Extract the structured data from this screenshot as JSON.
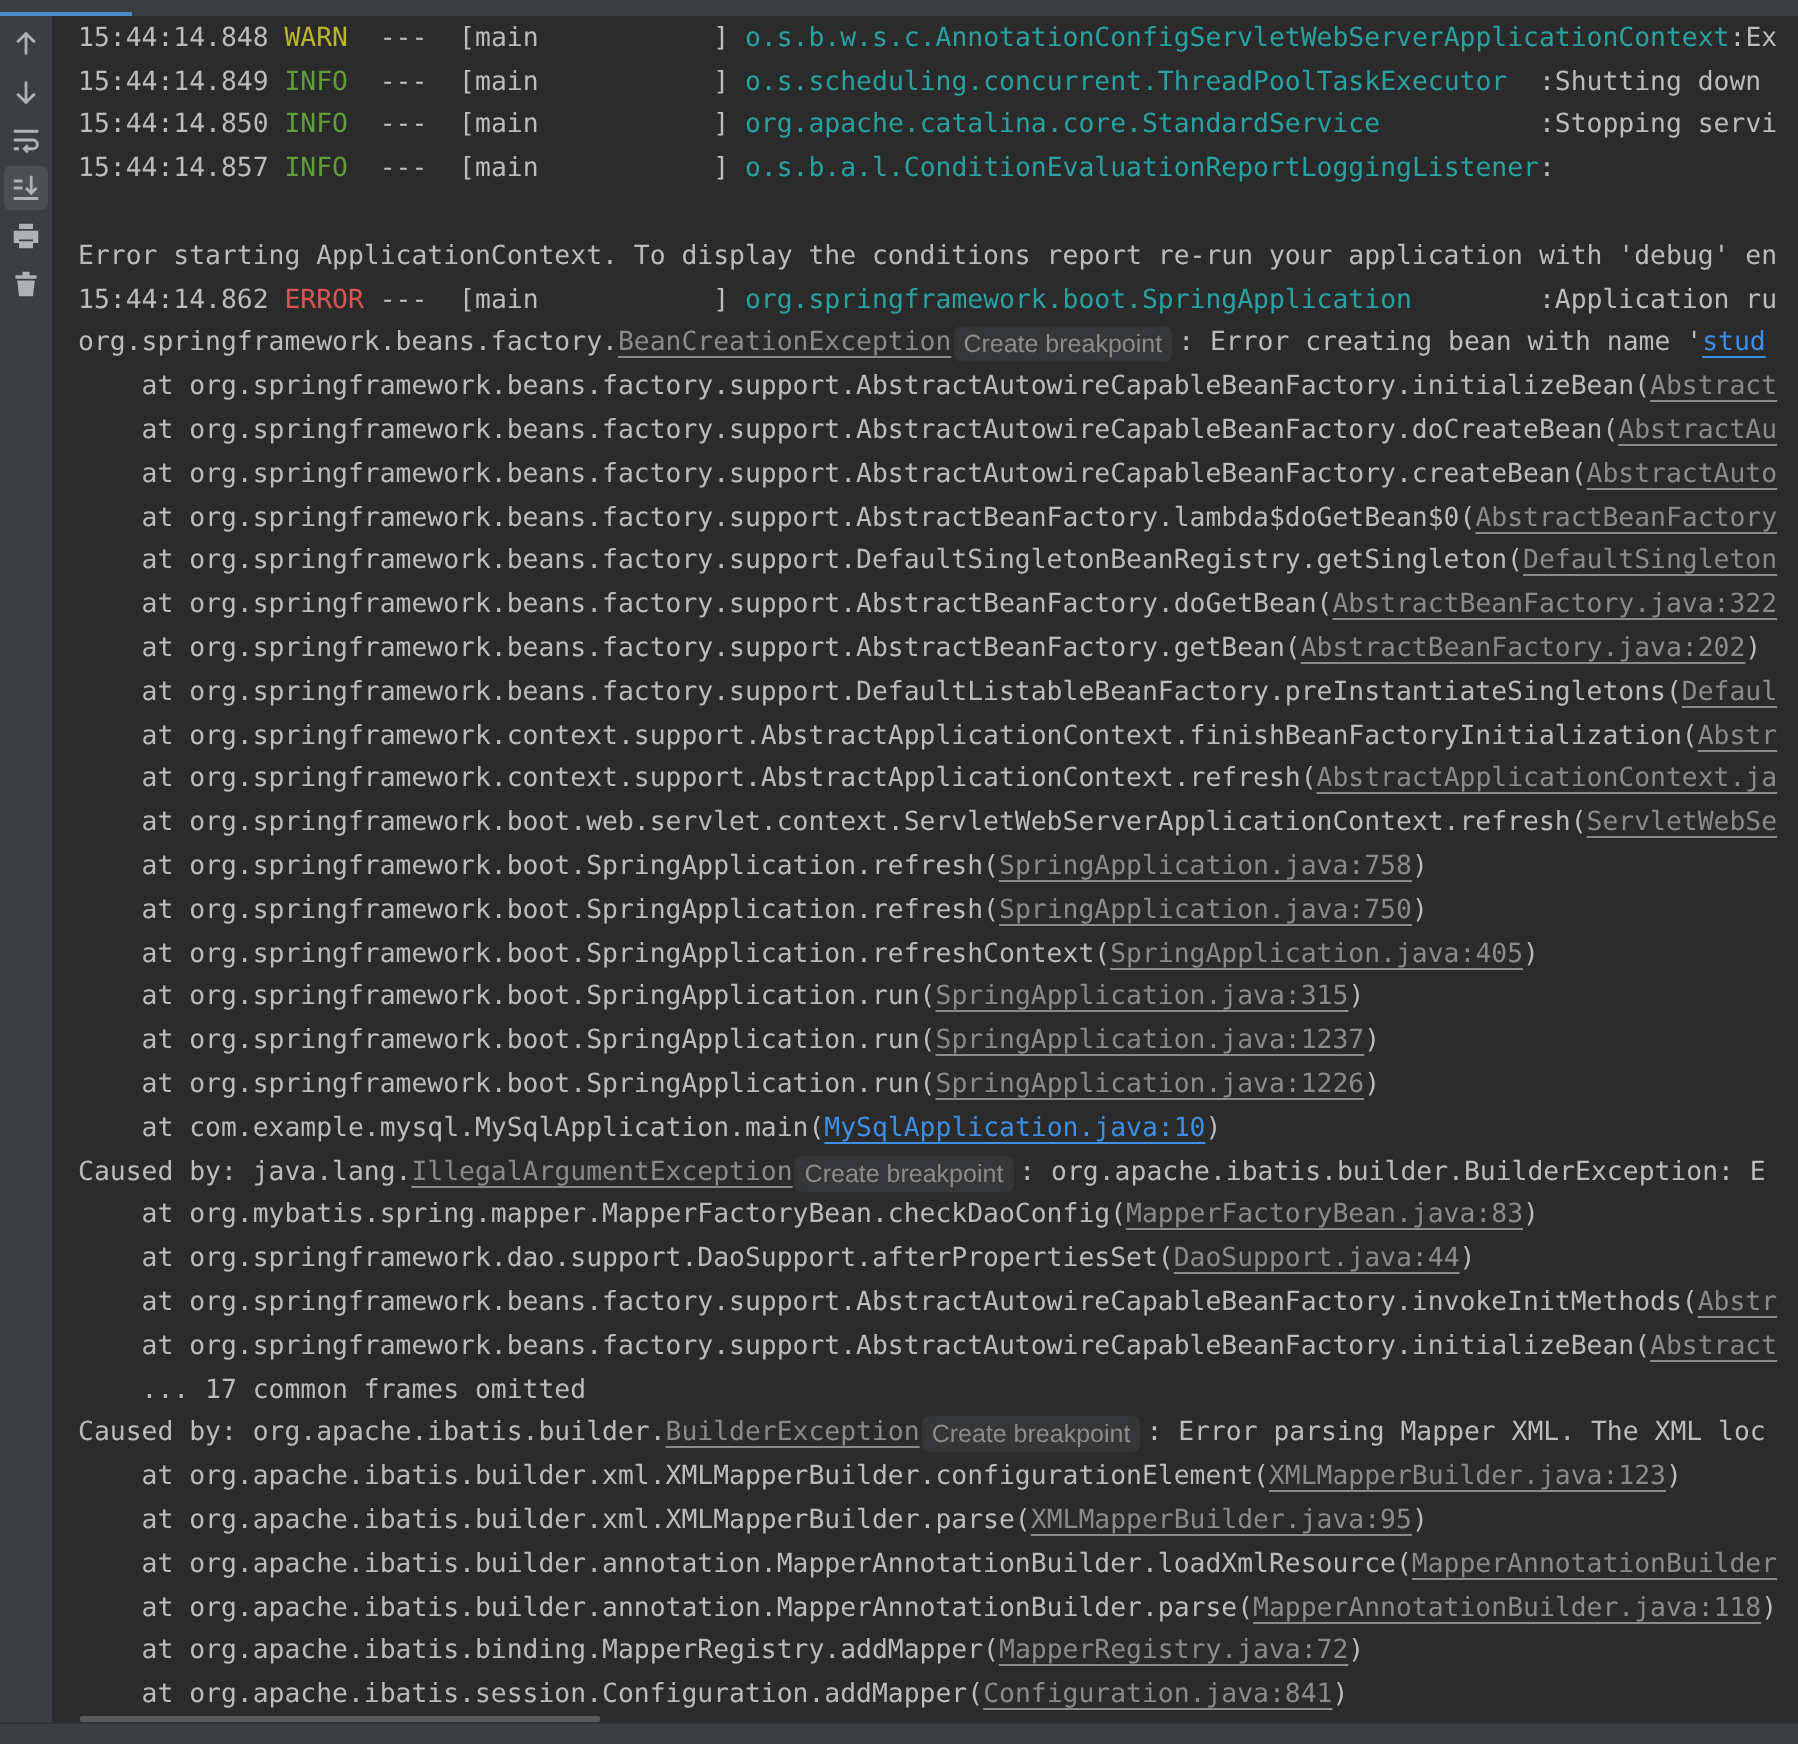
{
  "toolbar": [
    {
      "kind": "up",
      "active": false
    },
    {
      "kind": "down",
      "active": false
    },
    {
      "kind": "wrap",
      "active": false
    },
    {
      "kind": "scroll-end",
      "active": true
    },
    {
      "kind": "print",
      "active": false
    },
    {
      "kind": "trash",
      "active": false
    }
  ],
  "lines": [
    {
      "kind": "log",
      "segments": [
        {
          "kind": "text",
          "text": "15:44:14.848 "
        },
        {
          "kind": "warn",
          "text": "WARN"
        },
        {
          "kind": "text",
          "text": "  ---  [main           ] "
        },
        {
          "kind": "logger",
          "text": "o.s.b.w.s.c.AnnotationConfigServletWebServerApplicationContext"
        },
        {
          "kind": "text",
          "text": ":Ex"
        }
      ]
    },
    {
      "kind": "log",
      "segments": [
        {
          "kind": "text",
          "text": "15:44:14.849 "
        },
        {
          "kind": "info",
          "text": "INFO"
        },
        {
          "kind": "text",
          "text": "  ---  [main           ] "
        },
        {
          "kind": "logger",
          "text": "o.s.scheduling.concurrent.ThreadPoolTaskExecutor"
        },
        {
          "kind": "text",
          "text": "  :Shutting down"
        }
      ]
    },
    {
      "kind": "log",
      "segments": [
        {
          "kind": "text",
          "text": "15:44:14.850 "
        },
        {
          "kind": "info",
          "text": "INFO"
        },
        {
          "kind": "text",
          "text": "  ---  [main           ] "
        },
        {
          "kind": "logger",
          "text": "org.apache.catalina.core.StandardService"
        },
        {
          "kind": "text",
          "text": "          :Stopping servi"
        }
      ]
    },
    {
      "kind": "log",
      "segments": [
        {
          "kind": "text",
          "text": "15:44:14.857 "
        },
        {
          "kind": "info",
          "text": "INFO"
        },
        {
          "kind": "text",
          "text": "  ---  [main           ] "
        },
        {
          "kind": "logger",
          "text": "o.s.b.a.l.ConditionEvaluationReportLoggingListener"
        },
        {
          "kind": "text",
          "text": ":"
        }
      ]
    },
    {
      "kind": "blank"
    },
    {
      "kind": "log",
      "segments": [
        {
          "kind": "text",
          "text": "Error starting ApplicationContext. To display the conditions report re-run your application with 'debug' en"
        }
      ]
    },
    {
      "kind": "log",
      "segments": [
        {
          "kind": "text",
          "text": "15:44:14.862 "
        },
        {
          "kind": "error",
          "text": "ERROR"
        },
        {
          "kind": "text",
          "text": " ---  [main           ] "
        },
        {
          "kind": "logger",
          "text": "org.springframework.boot.SpringApplication"
        },
        {
          "kind": "text",
          "text": "        :Application ru"
        }
      ]
    },
    {
      "kind": "log",
      "segments": [
        {
          "kind": "text",
          "text": "org.springframework.beans.factory."
        },
        {
          "kind": "link",
          "text": "BeanCreationException"
        },
        {
          "kind": "hint",
          "text": "Create breakpoint"
        },
        {
          "kind": "text",
          "text": ": Error creating bean with name '"
        },
        {
          "kind": "bluelink",
          "text": "stud"
        }
      ]
    },
    {
      "kind": "log",
      "segments": [
        {
          "kind": "text",
          "text": "    at org.springframework.beans.factory.support.AbstractAutowireCapableBeanFactory.initializeBean("
        },
        {
          "kind": "link",
          "text": "Abstract"
        }
      ]
    },
    {
      "kind": "log",
      "segments": [
        {
          "kind": "text",
          "text": "    at org.springframework.beans.factory.support.AbstractAutowireCapableBeanFactory.doCreateBean("
        },
        {
          "kind": "link",
          "text": "AbstractAu"
        }
      ]
    },
    {
      "kind": "log",
      "segments": [
        {
          "kind": "text",
          "text": "    at org.springframework.beans.factory.support.AbstractAutowireCapableBeanFactory.createBean("
        },
        {
          "kind": "link",
          "text": "AbstractAuto"
        }
      ]
    },
    {
      "kind": "log",
      "segments": [
        {
          "kind": "text",
          "text": "    at org.springframework.beans.factory.support.AbstractBeanFactory.lambda$doGetBean$0("
        },
        {
          "kind": "link",
          "text": "AbstractBeanFactory"
        }
      ]
    },
    {
      "kind": "log",
      "segments": [
        {
          "kind": "text",
          "text": "    at org.springframework.beans.factory.support.DefaultSingletonBeanRegistry.getSingleton("
        },
        {
          "kind": "link",
          "text": "DefaultSingleton"
        }
      ]
    },
    {
      "kind": "log",
      "segments": [
        {
          "kind": "text",
          "text": "    at org.springframework.beans.factory.support.AbstractBeanFactory.doGetBean("
        },
        {
          "kind": "link",
          "text": "AbstractBeanFactory.java:322"
        }
      ]
    },
    {
      "kind": "log",
      "segments": [
        {
          "kind": "text",
          "text": "    at org.springframework.beans.factory.support.AbstractBeanFactory.getBean("
        },
        {
          "kind": "link",
          "text": "AbstractBeanFactory.java:202"
        },
        {
          "kind": "text",
          "text": ")"
        }
      ]
    },
    {
      "kind": "log",
      "segments": [
        {
          "kind": "text",
          "text": "    at org.springframework.beans.factory.support.DefaultListableBeanFactory.preInstantiateSingletons("
        },
        {
          "kind": "link",
          "text": "Defaul"
        }
      ]
    },
    {
      "kind": "log",
      "segments": [
        {
          "kind": "text",
          "text": "    at org.springframework.context.support.AbstractApplicationContext.finishBeanFactoryInitialization("
        },
        {
          "kind": "link",
          "text": "Abstr"
        }
      ]
    },
    {
      "kind": "log",
      "segments": [
        {
          "kind": "text",
          "text": "    at org.springframework.context.support.AbstractApplicationContext.refresh("
        },
        {
          "kind": "link",
          "text": "AbstractApplicationContext.ja"
        }
      ]
    },
    {
      "kind": "log",
      "segments": [
        {
          "kind": "text",
          "text": "    at org.springframework.boot.web.servlet.context.ServletWebServerApplicationContext.refresh("
        },
        {
          "kind": "link",
          "text": "ServletWebSe"
        }
      ]
    },
    {
      "kind": "log",
      "segments": [
        {
          "kind": "text",
          "text": "    at org.springframework.boot.SpringApplication.refresh("
        },
        {
          "kind": "link",
          "text": "SpringApplication.java:758"
        },
        {
          "kind": "text",
          "text": ")"
        }
      ]
    },
    {
      "kind": "log",
      "segments": [
        {
          "kind": "text",
          "text": "    at org.springframework.boot.SpringApplication.refresh("
        },
        {
          "kind": "link",
          "text": "SpringApplication.java:750"
        },
        {
          "kind": "text",
          "text": ")"
        }
      ]
    },
    {
      "kind": "log",
      "segments": [
        {
          "kind": "text",
          "text": "    at org.springframework.boot.SpringApplication.refreshContext("
        },
        {
          "kind": "link",
          "text": "SpringApplication.java:405"
        },
        {
          "kind": "text",
          "text": ")"
        }
      ]
    },
    {
      "kind": "log",
      "segments": [
        {
          "kind": "text",
          "text": "    at org.springframework.boot.SpringApplication.run("
        },
        {
          "kind": "link",
          "text": "SpringApplication.java:315"
        },
        {
          "kind": "text",
          "text": ")"
        }
      ]
    },
    {
      "kind": "log",
      "segments": [
        {
          "kind": "text",
          "text": "    at org.springframework.boot.SpringApplication.run("
        },
        {
          "kind": "link",
          "text": "SpringApplication.java:1237"
        },
        {
          "kind": "text",
          "text": ")"
        }
      ]
    },
    {
      "kind": "log",
      "segments": [
        {
          "kind": "text",
          "text": "    at org.springframework.boot.SpringApplication.run("
        },
        {
          "kind": "link",
          "text": "SpringApplication.java:1226"
        },
        {
          "kind": "text",
          "text": ")"
        }
      ]
    },
    {
      "kind": "log",
      "segments": [
        {
          "kind": "text",
          "text": "    at com.example.mysql.MySqlApplication.main("
        },
        {
          "kind": "bluelink",
          "text": "MySqlApplication.java:10"
        },
        {
          "kind": "text",
          "text": ")"
        }
      ]
    },
    {
      "kind": "log",
      "segments": [
        {
          "kind": "text",
          "text": "Caused by: java.lang."
        },
        {
          "kind": "link",
          "text": "IllegalArgumentException"
        },
        {
          "kind": "hint",
          "text": "Create breakpoint"
        },
        {
          "kind": "text",
          "text": ": org.apache.ibatis.builder.BuilderException: E"
        }
      ]
    },
    {
      "kind": "log",
      "segments": [
        {
          "kind": "text",
          "text": "    at org.mybatis.spring.mapper.MapperFactoryBean.checkDaoConfig("
        },
        {
          "kind": "link",
          "text": "MapperFactoryBean.java:83"
        },
        {
          "kind": "text",
          "text": ")"
        }
      ]
    },
    {
      "kind": "log",
      "segments": [
        {
          "kind": "text",
          "text": "    at org.springframework.dao.support.DaoSupport.afterPropertiesSet("
        },
        {
          "kind": "link",
          "text": "DaoSupport.java:44"
        },
        {
          "kind": "text",
          "text": ")"
        }
      ]
    },
    {
      "kind": "log",
      "segments": [
        {
          "kind": "text",
          "text": "    at org.springframework.beans.factory.support.AbstractAutowireCapableBeanFactory.invokeInitMethods("
        },
        {
          "kind": "link",
          "text": "Abstr"
        }
      ]
    },
    {
      "kind": "log",
      "segments": [
        {
          "kind": "text",
          "text": "    at org.springframework.beans.factory.support.AbstractAutowireCapableBeanFactory.initializeBean("
        },
        {
          "kind": "link",
          "text": "Abstract"
        }
      ]
    },
    {
      "kind": "log",
      "segments": [
        {
          "kind": "text",
          "text": "    ... 17 common frames omitted"
        }
      ]
    },
    {
      "kind": "log",
      "segments": [
        {
          "kind": "text",
          "text": "Caused by: org.apache.ibatis.builder."
        },
        {
          "kind": "link",
          "text": "BuilderException"
        },
        {
          "kind": "hint",
          "text": "Create breakpoint"
        },
        {
          "kind": "text",
          "text": ": Error parsing Mapper XML. The XML loc"
        }
      ]
    },
    {
      "kind": "log",
      "segments": [
        {
          "kind": "text",
          "text": "    at org.apache.ibatis.builder.xml.XMLMapperBuilder.configurationElement("
        },
        {
          "kind": "link",
          "text": "XMLMapperBuilder.java:123"
        },
        {
          "kind": "text",
          "text": ")"
        }
      ]
    },
    {
      "kind": "log",
      "segments": [
        {
          "kind": "text",
          "text": "    at org.apache.ibatis.builder.xml.XMLMapperBuilder.parse("
        },
        {
          "kind": "link",
          "text": "XMLMapperBuilder.java:95"
        },
        {
          "kind": "text",
          "text": ")"
        }
      ]
    },
    {
      "kind": "log",
      "segments": [
        {
          "kind": "text",
          "text": "    at org.apache.ibatis.builder.annotation.MapperAnnotationBuilder.loadXmlResource("
        },
        {
          "kind": "link",
          "text": "MapperAnnotationBuilder"
        }
      ]
    },
    {
      "kind": "log",
      "segments": [
        {
          "kind": "text",
          "text": "    at org.apache.ibatis.builder.annotation.MapperAnnotationBuilder.parse("
        },
        {
          "kind": "link",
          "text": "MapperAnnotationBuilder.java:118"
        },
        {
          "kind": "text",
          "text": ")"
        }
      ]
    },
    {
      "kind": "log",
      "segments": [
        {
          "kind": "text",
          "text": "    at org.apache.ibatis.binding.MapperRegistry.addMapper("
        },
        {
          "kind": "link",
          "text": "MapperRegistry.java:72"
        },
        {
          "kind": "text",
          "text": ")"
        }
      ]
    },
    {
      "kind": "log",
      "segments": [
        {
          "kind": "text",
          "text": "    at org.apache.ibatis.session.Configuration.addMapper("
        },
        {
          "kind": "link",
          "text": "Configuration.java:841"
        },
        {
          "kind": "text",
          "text": ")"
        }
      ]
    }
  ]
}
